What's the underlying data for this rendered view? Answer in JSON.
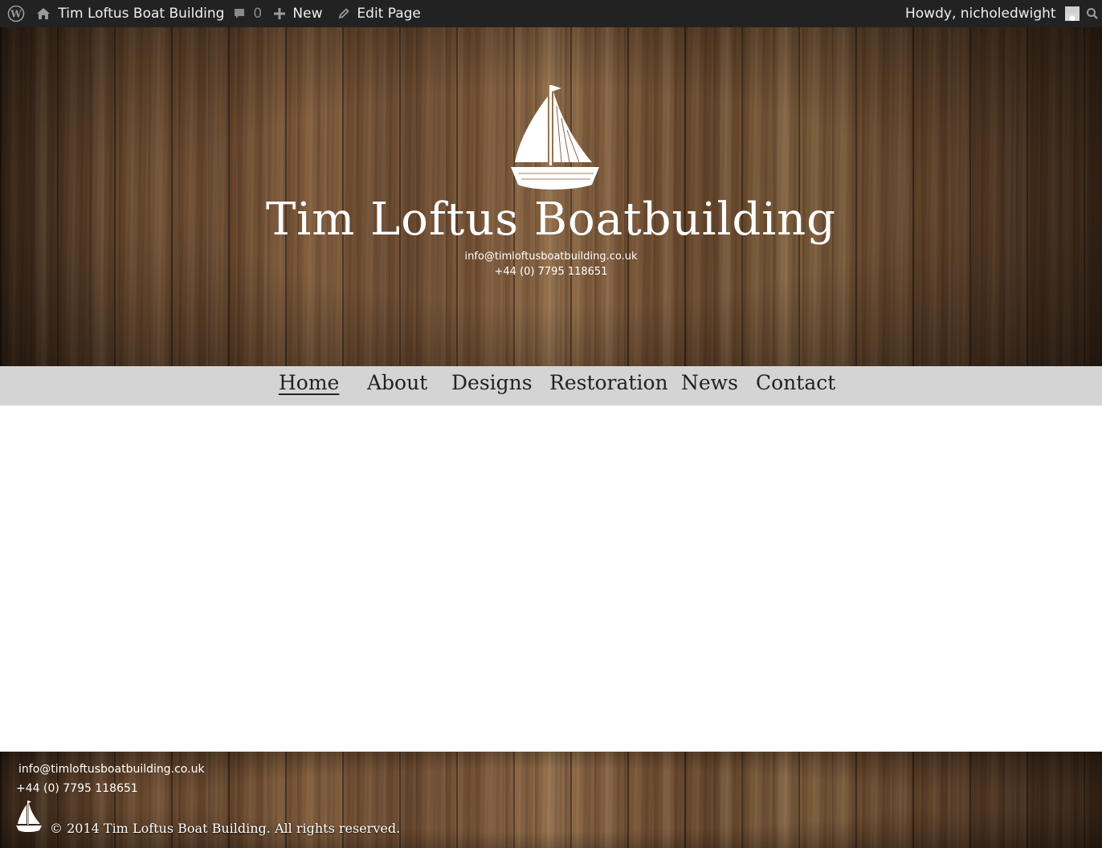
{
  "admin_bar": {
    "site_name": "Tim Loftus Boat Building",
    "comments_count": "0",
    "new_label": "New",
    "edit_label": "Edit Page",
    "greeting": "Howdy, nicholedwight"
  },
  "header": {
    "site_title": "Tim Loftus Boatbuilding",
    "email": "info@timloftusboatbuilding.co.uk",
    "phone": "+44 (0) 7795 118651"
  },
  "nav": {
    "items": [
      {
        "label": "Home",
        "active": true
      },
      {
        "label": "About",
        "active": false
      },
      {
        "label": "Designs",
        "active": false
      },
      {
        "label": "Restoration",
        "active": false
      },
      {
        "label": "News",
        "active": false
      },
      {
        "label": "Contact",
        "active": false
      }
    ]
  },
  "footer": {
    "email": "info@timloftusboatbuilding.co.uk",
    "phone": "+44 (0) 7795 118651",
    "copyright": "© 2014 Tim Loftus Boat Building. All rights reserved."
  },
  "colors": {
    "admin_bar_bg": "#222222",
    "nav_bg": "#d4d4d4",
    "wood": "#6b4a30"
  },
  "icons": [
    "wordpress-logo-icon",
    "home-icon",
    "comment-icon",
    "plus-icon",
    "pencil-icon",
    "avatar-icon",
    "search-icon",
    "sailboat-logo-icon"
  ]
}
